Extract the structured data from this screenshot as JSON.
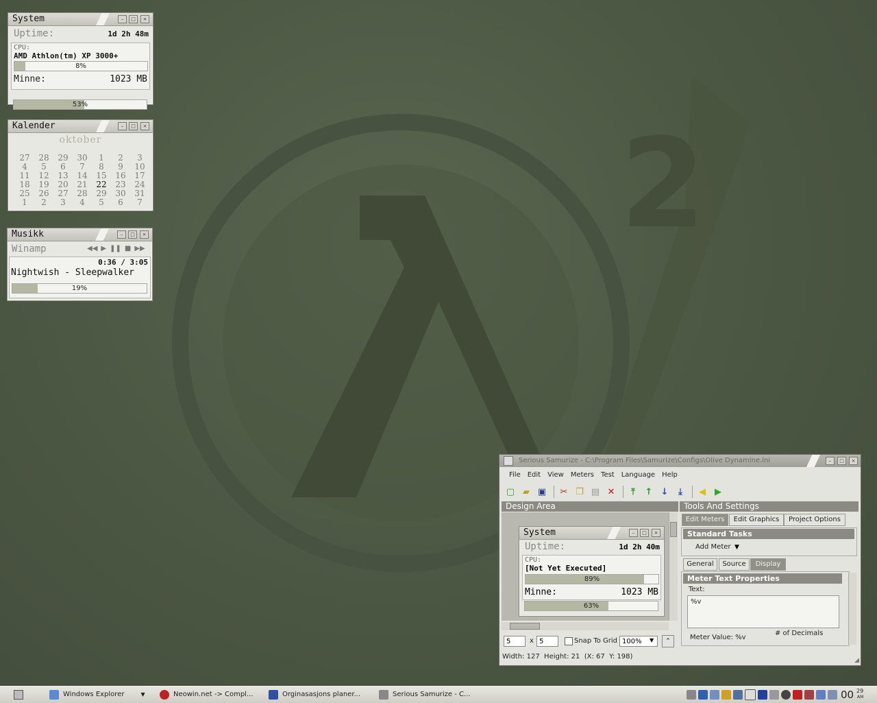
{
  "widgets": {
    "system": {
      "title": "System",
      "uptime_label": "Uptime:",
      "uptime_value": "1d 2h 48m",
      "cpu_label": "CPU:",
      "cpu_name": "AMD Athlon(tm) XP 3000+",
      "cpu_percent": 8,
      "cpu_percent_text": "8%",
      "mem_label": "Minne:",
      "mem_value": "1023 MB",
      "mem_percent": 53,
      "mem_percent_text": "53%"
    },
    "calendar": {
      "title": "Kalender",
      "month": "oktober",
      "today": "22",
      "weeks": [
        [
          "27",
          "28",
          "29",
          "30",
          "1",
          "2",
          "3"
        ],
        [
          "4",
          "5",
          "6",
          "7",
          "8",
          "9",
          "10"
        ],
        [
          "11",
          "12",
          "13",
          "14",
          "15",
          "16",
          "17"
        ],
        [
          "18",
          "19",
          "20",
          "21",
          "22",
          "23",
          "24"
        ],
        [
          "25",
          "26",
          "27",
          "28",
          "29",
          "30",
          "31"
        ],
        [
          "1",
          "2",
          "3",
          "4",
          "5",
          "6",
          "7"
        ]
      ]
    },
    "music": {
      "title": "Musikk",
      "player": "Winamp",
      "time": "0:36 / 3:05",
      "track": "Nightwish - Sleepwalker",
      "progress": 19,
      "progress_text": "19%"
    }
  },
  "app": {
    "title": "Serious Samurize - C:\\Program Files\\Samurize\\Configs\\Olive Dynamine.ini",
    "menu": [
      "File",
      "Edit",
      "View",
      "Meters",
      "Test",
      "Language",
      "Help"
    ],
    "design_area_label": "Design Area",
    "tools_label": "Tools And Settings",
    "tabs": [
      "Edit Meters",
      "Edit Graphics",
      "Project Options"
    ],
    "standard_tasks": "Standard Tasks",
    "add_meter": "Add Meter",
    "subtabs": [
      "General",
      "Source",
      "Display"
    ],
    "meter_text_props": "Meter Text Properties",
    "text_label": "Text:",
    "text_value": "%v",
    "meter_value_label": "Meter Value: %v",
    "decimals_label": "# of Decimals",
    "preview": {
      "title": "System",
      "uptime_label": "Uptime:",
      "uptime_value": "1d 2h 40m",
      "cpu_label": "CPU:",
      "cpu_name": "[Not Yet Executed]",
      "cpu_percent": 89,
      "cpu_percent_text": "89%",
      "mem_label": "Minne:",
      "mem_value": "1023 MB",
      "mem_percent": 63,
      "mem_percent_text": "63%"
    },
    "grid_x": "5",
    "grid_sep": "x",
    "grid_y": "5",
    "snap_label": "Snap To Grid",
    "zoom": "100%",
    "status": "Width: 127  Height: 21  (X: 67  Y: 198)"
  },
  "taskbar": {
    "tasks": [
      "Windows Explorer",
      "Neowin.net -> Compl...",
      "Orginasasjons planer...",
      "Serious Samurize - C..."
    ],
    "clock_hour": "00",
    "clock_min": "29",
    "clock_ampm": "AM"
  },
  "colors": {
    "desktop": "#4d5944",
    "widget_bg": "#e8e8e2",
    "bar_fill": "#b4b8a2",
    "accent_gray": "#8a8a82"
  }
}
